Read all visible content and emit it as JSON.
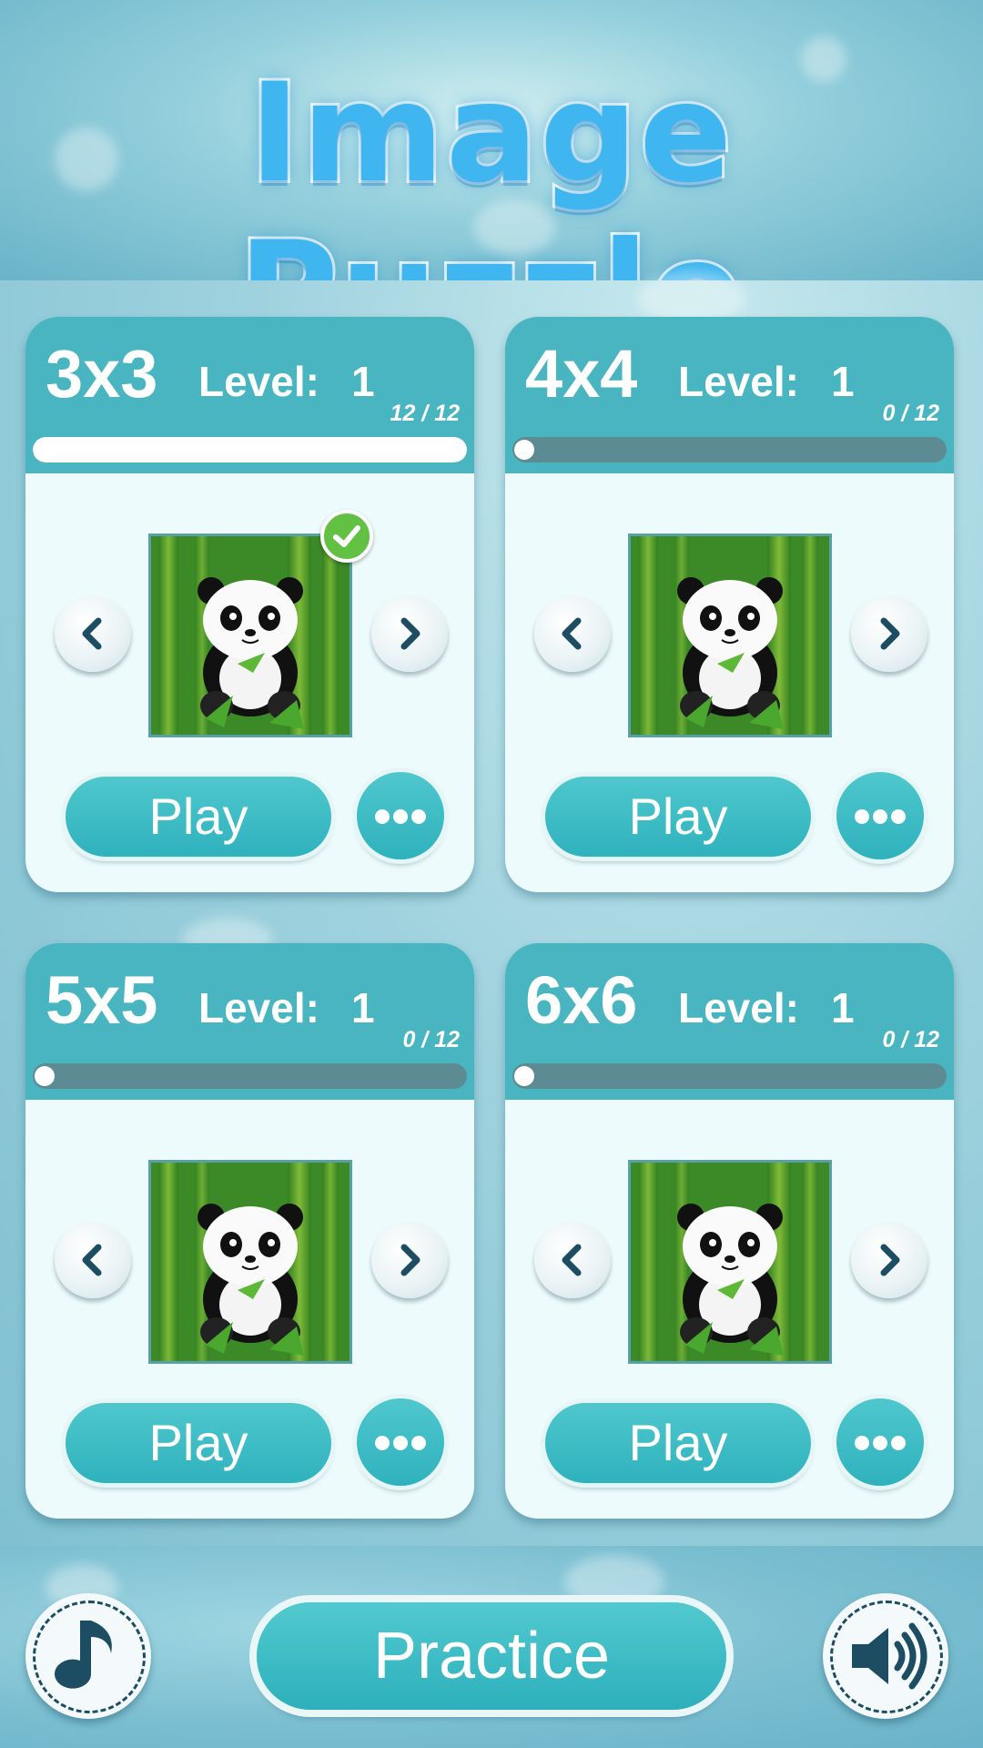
{
  "header": {
    "title": "Image Puzzle"
  },
  "cards": [
    {
      "size": "3x3",
      "level_label": "Level:",
      "level": "1",
      "progress_text": "12 / 12",
      "progress": 1.0,
      "completed": true,
      "play_label": "Play"
    },
    {
      "size": "4x4",
      "level_label": "Level:",
      "level": "1",
      "progress_text": "0 / 12",
      "progress": 0.0,
      "completed": false,
      "play_label": "Play"
    },
    {
      "size": "5x5",
      "level_label": "Level:",
      "level": "1",
      "progress_text": "0 / 12",
      "progress": 0.0,
      "completed": false,
      "play_label": "Play"
    },
    {
      "size": "6x6",
      "level_label": "Level:",
      "level": "1",
      "progress_text": "0 / 12",
      "progress": 0.0,
      "completed": false,
      "play_label": "Play"
    }
  ],
  "bottom": {
    "practice_label": "Practice",
    "music_icon": "music-note-icon",
    "sound_icon": "speaker-icon"
  },
  "colors": {
    "accent": "#48b5c0",
    "button": "#2fb2bd",
    "title": "#3fb6ef",
    "check": "#62c043"
  }
}
